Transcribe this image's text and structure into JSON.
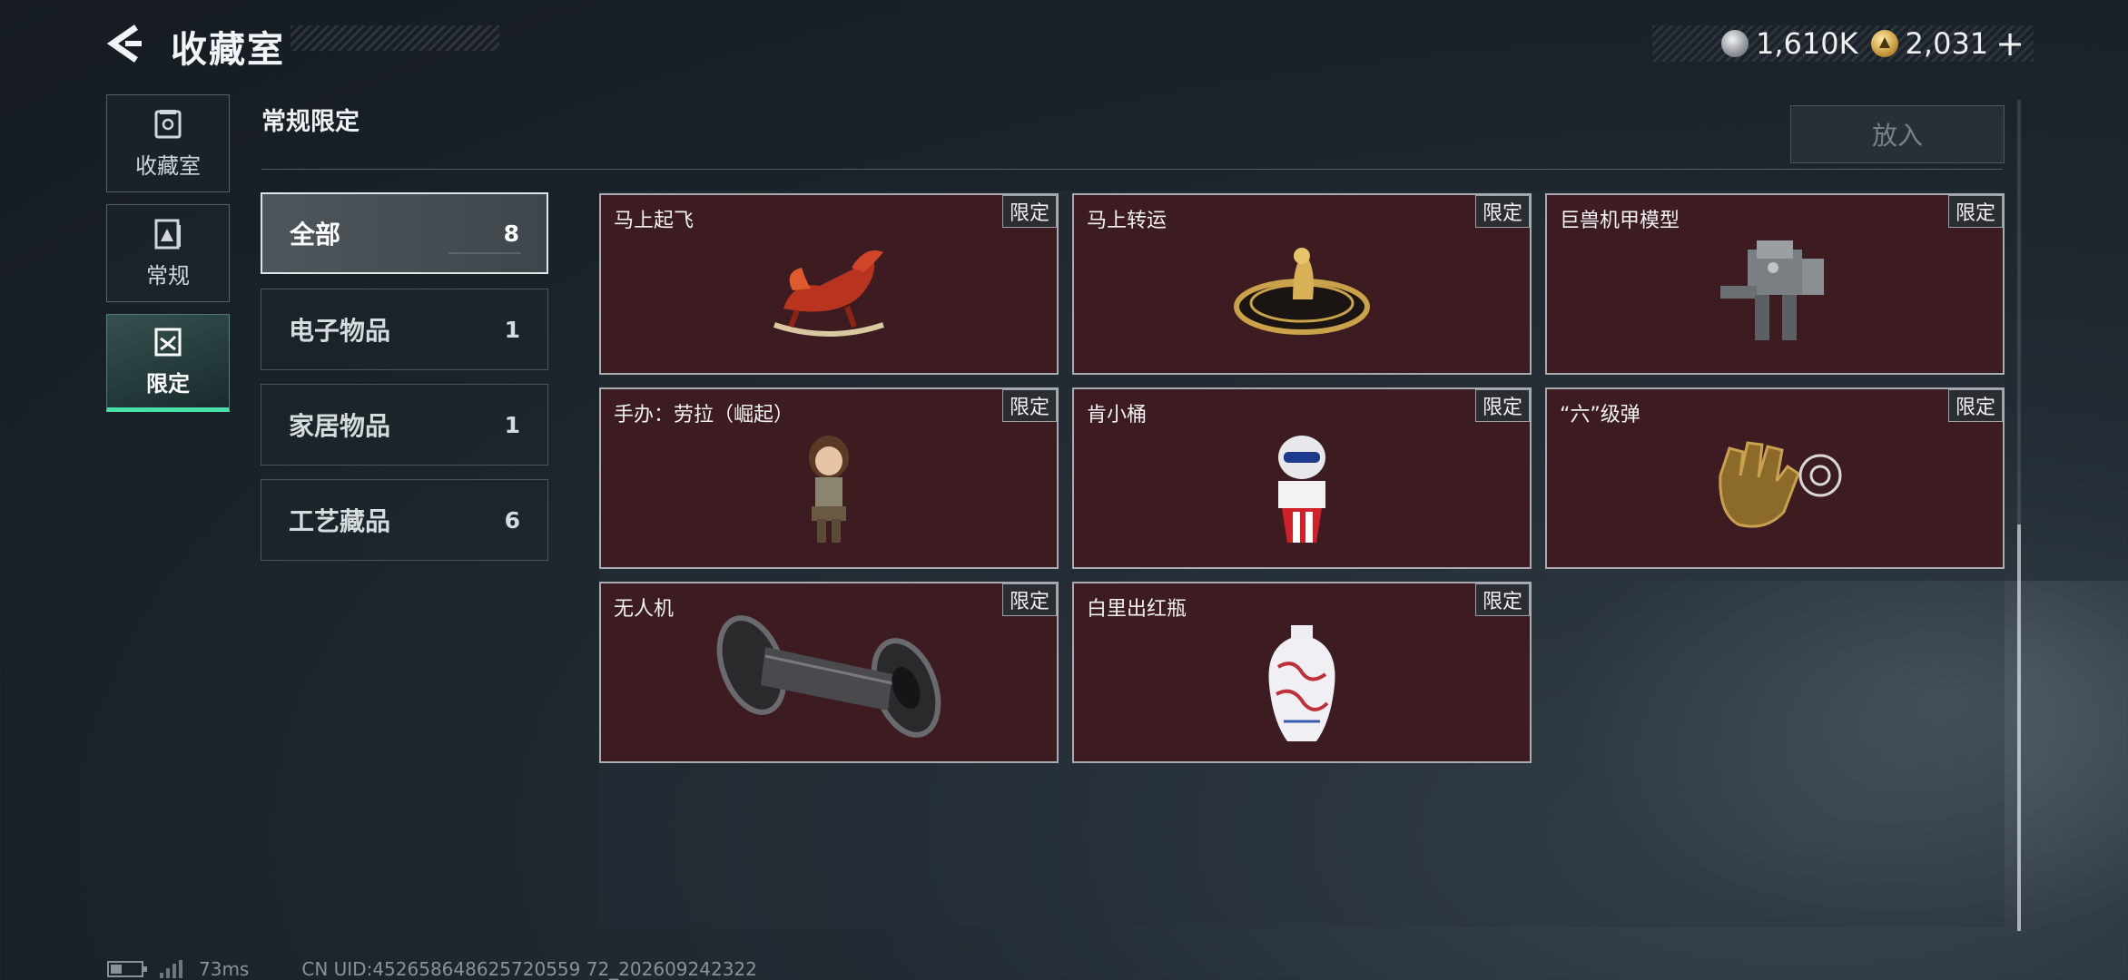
{
  "header": {
    "title": "收藏室",
    "currency_silver": "1,610K",
    "currency_gold": "2,031",
    "currency_add": "+"
  },
  "sidebar": {
    "tabs": [
      {
        "label": "收藏室",
        "icon": "collection-room-icon"
      },
      {
        "label": "常规",
        "icon": "regular-icon"
      },
      {
        "label": "限定",
        "icon": "limited-icon",
        "active": true
      }
    ]
  },
  "section": {
    "title": "常规限定",
    "put_button": "放入"
  },
  "categories": [
    {
      "name": "全部",
      "count": "8",
      "active": true
    },
    {
      "name": "电子物品",
      "count": "1"
    },
    {
      "name": "家居物品",
      "count": "1"
    },
    {
      "name": "工艺藏品",
      "count": "6"
    }
  ],
  "items": [
    {
      "name": "马上起飞",
      "badge": "限定",
      "art": "rocking-horse-icon"
    },
    {
      "name": "马上转运",
      "badge": "限定",
      "art": "golden-wheel-icon"
    },
    {
      "name": "巨兽机甲模型",
      "badge": "限定",
      "art": "mech-model-icon"
    },
    {
      "name": "手办：劳拉（崛起）",
      "badge": "限定",
      "art": "lara-figure-icon"
    },
    {
      "name": "肯小桶",
      "badge": "限定",
      "art": "bucket-figure-icon"
    },
    {
      "name": "“六”级弹",
      "badge": "限定",
      "art": "gold-hand-icon"
    },
    {
      "name": "无人机",
      "badge": "限定",
      "art": "drone-icon"
    },
    {
      "name": "白里出红瓶",
      "badge": "限定",
      "art": "vase-icon"
    }
  ],
  "footer": {
    "ping": "73ms",
    "uid": "CN UID:452658648625720559 72_202609242322"
  },
  "colors": {
    "accent_green": "#48e0a8",
    "card_bg": "#3c1c20"
  }
}
